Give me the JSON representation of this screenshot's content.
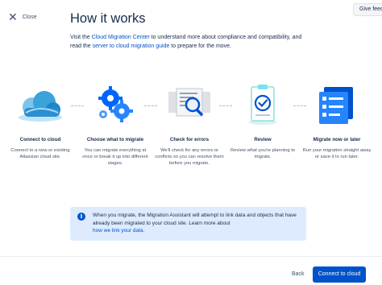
{
  "header": {
    "close_label": "Close",
    "feedback_label": "Give feedback",
    "title": "How it works"
  },
  "intro": {
    "text_1": "Visit the ",
    "link_1": "Cloud Migration Center",
    "text_2": " to understand more about compliance and compatibility, and read the ",
    "link_2": "server to cloud migration guide",
    "text_3": " to prepare for the move."
  },
  "steps": [
    {
      "title": "Connect to cloud",
      "description": "Connect to a new or existing Atlassian cloud site.",
      "icon": "cloud-icon"
    },
    {
      "title": "Choose what to migrate",
      "description": "You can migrate everything at once or break it up into different stages.",
      "icon": "gears-icon"
    },
    {
      "title": "Check for errors",
      "description": "We'll check for any errors or conflicts so you can resolve them before you migrate.",
      "icon": "magnifier-documents-icon"
    },
    {
      "title": "Review",
      "description": "Review what you're planning to migrate.",
      "icon": "clipboard-check-icon"
    },
    {
      "title": "Migrate now or later",
      "description": "Run your migration straight away or save it to run later.",
      "icon": "calendar-list-icon"
    }
  ],
  "info": {
    "icon": "info-icon",
    "text": "When you migrate, the Migration Assistant will attempt to link data and objects that have already been migrated to your cloud site. Learn more about ",
    "link": "how we link your data."
  },
  "footer": {
    "back_label": "Back",
    "primary_label": "Connect to cloud"
  },
  "colors": {
    "primary": "#0052cc",
    "info_bg": "#deebff",
    "text": "#172b4d"
  }
}
